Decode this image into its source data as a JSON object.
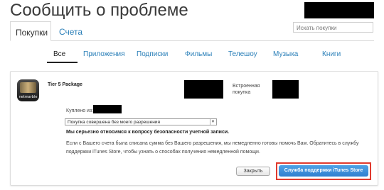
{
  "header": {
    "title": "Сообщить о проблеме",
    "search_placeholder": "Искать покупки"
  },
  "top_tabs": [
    {
      "label": "Покупки",
      "active": true
    },
    {
      "label": "Счета",
      "active": false
    }
  ],
  "categories": [
    {
      "label": "Все",
      "active": true
    },
    {
      "label": "Приложения",
      "active": false
    },
    {
      "label": "Подписки",
      "active": false
    },
    {
      "label": "Фильмы",
      "active": false
    },
    {
      "label": "Телешоу",
      "active": false
    },
    {
      "label": "Музыка",
      "active": false
    },
    {
      "label": "Книги",
      "active": false
    }
  ],
  "item": {
    "icon_brand": "netmarble",
    "title": "Tier 5 Package",
    "purchase_type": "Встроенная покупка"
  },
  "report": {
    "bought_from_label": "Куплено из:",
    "reason_selected": "Покупка совершена без моего разрешения",
    "warning": "Мы серьезно относимся к вопросу безопасности учетной записи.",
    "info": "Если с Вашего счета была списана сумма без Вашего разрешения, мы немедленно готовы помочь Вам. Обратитесь в службу поддержки iTunes Store, чтобы узнать о способах получения немедленной помощи.",
    "close_label": "Закрыть",
    "support_label": "Служба поддержки iTunes Store"
  },
  "colors": {
    "link": "#2a7fb8",
    "support_button": "#3a8ed8",
    "highlight": "#e03a2e"
  }
}
